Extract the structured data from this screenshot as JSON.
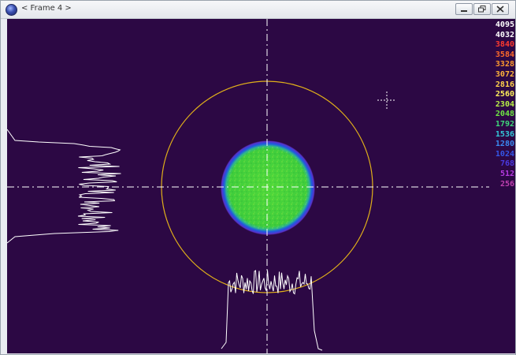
{
  "window": {
    "title": "< Frame 4 >",
    "buttons": [
      "minimize",
      "restore",
      "close"
    ]
  },
  "colors": {
    "background": "#2c0844",
    "beam_core": "#46d23a",
    "beam_edge": "#1a46d8",
    "ring": "#e0b01a",
    "crosshair": "#ffffff",
    "profile": "#ffffff"
  },
  "color_scale": [
    {
      "label": "4095",
      "color": "#ffffff"
    },
    {
      "label": "4032",
      "color": "#ffffff"
    },
    {
      "label": "3840",
      "color": "#ff3b2e"
    },
    {
      "label": "3584",
      "color": "#ff6a2a"
    },
    {
      "label": "3328",
      "color": "#ff9a2e"
    },
    {
      "label": "3072",
      "color": "#ffb43a"
    },
    {
      "label": "2816",
      "color": "#ffd24a"
    },
    {
      "label": "2560",
      "color": "#fff15a"
    },
    {
      "label": "2304",
      "color": "#b8f046"
    },
    {
      "label": "2048",
      "color": "#6ee842"
    },
    {
      "label": "1792",
      "color": "#3ed87a"
    },
    {
      "label": "1536",
      "color": "#33c8d8"
    },
    {
      "label": "1280",
      "color": "#3a8af0"
    },
    {
      "label": "1024",
      "color": "#3456e8"
    },
    {
      "label": "768",
      "color": "#4a3ae0"
    },
    {
      "label": "512",
      "color": "#b43ae0"
    },
    {
      "label": "256",
      "color": "#c040b0"
    }
  ]
}
